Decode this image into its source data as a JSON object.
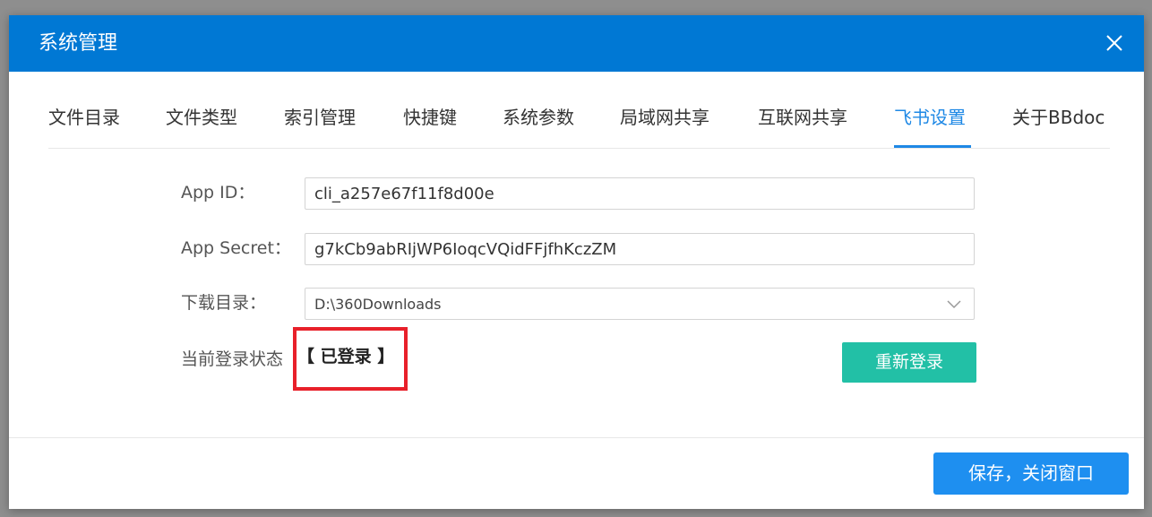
{
  "dialog": {
    "title": "系统管理",
    "close_icon": "close-icon"
  },
  "tabs": [
    {
      "label": "文件目录",
      "active": false
    },
    {
      "label": "文件类型",
      "active": false
    },
    {
      "label": "索引管理",
      "active": false
    },
    {
      "label": "快捷键",
      "active": false
    },
    {
      "label": "系统参数",
      "active": false
    },
    {
      "label": "局域网共享",
      "active": false
    },
    {
      "label": "互联网共享",
      "active": false
    },
    {
      "label": "飞书设置",
      "active": true
    },
    {
      "label": "关于BBdoc",
      "active": false
    }
  ],
  "form": {
    "app_id_label": "App ID：",
    "app_id_value": "cli_a257e67f11f8d00e",
    "app_secret_label": "App Secret：",
    "app_secret_value": "g7kCb9abRIjWP6IoqcVQidFFjfhKczZM",
    "download_dir_label": "下载目录：",
    "download_dir_value": "D:\\360Downloads",
    "login_status_label": "当前登录状态",
    "login_status_value": "【 已登录 】"
  },
  "buttons": {
    "relogin_label": "重新登录",
    "save_close_label": "保存，关闭窗口"
  },
  "colors": {
    "titlebar": "#0078d4",
    "active_tab": "#1e88e5",
    "relogin_button": "#22c0a6",
    "save_button": "#1e8ff0",
    "highlight_box": "#e8202a"
  }
}
